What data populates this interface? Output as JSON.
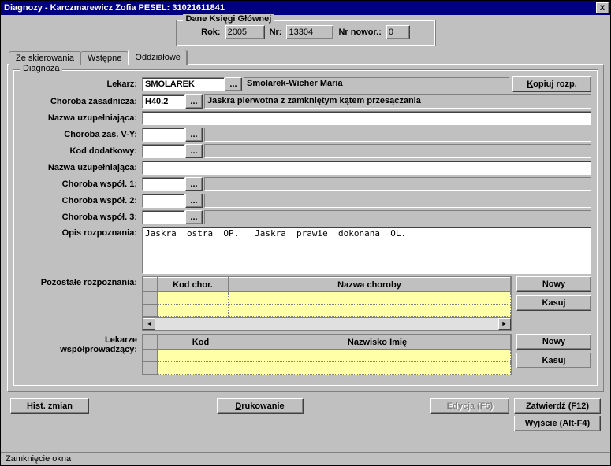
{
  "title": "Diagnozy -   Karczmarewicz Zofia  PESEL: 31021611841",
  "dane": {
    "legend": "Dane Księgi Głównej",
    "rok_label": "Rok:",
    "rok": "2005",
    "nr_label": "Nr:",
    "nr": "13304",
    "nrnowor_label": "Nr nowor.:",
    "nrnowor": "0"
  },
  "tabs": {
    "t1": "Ze skierowania",
    "t2": "Wstępne",
    "t3": "Oddziałowe"
  },
  "diag": {
    "legend": "Diagnoza",
    "lekarz_label": "Lekarz:",
    "lekarz_kod": "SMOLAREK",
    "lekarz_nazwa": "Smolarek-Wicher Maria",
    "kopiuj": "Kopiuj rozp.",
    "chz_label": "Choroba zasadnicza:",
    "chz_kod": "H40.2",
    "chz_nazwa": "Jaskra pierwotna z zamkniętym kątem przesączania",
    "nazwau1_label": "Nazwa uzupełniająca:",
    "chvy_label": "Choroba zas. V-Y:",
    "kodd_label": "Kod dodatkowy:",
    "nazwau2_label": "Nazwa uzupełniająca:",
    "chw1_label": "Choroba współ. 1:",
    "chw2_label": "Choroba współ. 2:",
    "chw3_label": "Choroba współ. 3:",
    "opis_label": "Opis rozpoznania:",
    "opis": "Jaskra  ostra  OP.   Jaskra  prawie  dokonana  OL.",
    "pozostale_label": "Pozostałe rozpoznania:",
    "g1_col1": "Kod chor.",
    "g1_col2": "Nazwa choroby",
    "nowy": "Nowy",
    "kasuj": "Kasuj",
    "lekarzewsp_label1": "Lekarze",
    "lekarzewsp_label2": "współprowadzący:",
    "g2_col1": "Kod",
    "g2_col2": "Nazwisko Imię"
  },
  "bottom": {
    "hist": "Hist. zmian",
    "druk": "Drukowanie",
    "edycja": "Edycja (F6)",
    "zatw": "Zatwierdź (F12)",
    "wyjscie": "Wyjście (Alt-F4)"
  },
  "status": "Zamknięcie okna"
}
